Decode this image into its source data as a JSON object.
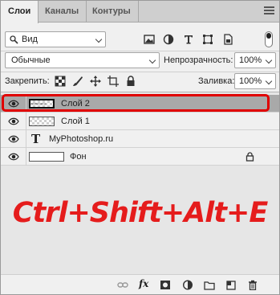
{
  "tabs": [
    {
      "label": "Слои",
      "active": true
    },
    {
      "label": "Каналы",
      "active": false
    },
    {
      "label": "Контуры",
      "active": false
    }
  ],
  "filter": {
    "kind_label": "Вид",
    "icons": [
      "image-filter-icon",
      "adjustment-filter-icon",
      "type-filter-icon",
      "shape-filter-icon",
      "smart-object-filter-icon"
    ]
  },
  "blend": {
    "mode": "Обычные",
    "opacity_label": "Непрозрачность:",
    "opacity_value": "100%"
  },
  "lock": {
    "label": "Закрепить:",
    "fill_label": "Заливка:",
    "fill_value": "100%"
  },
  "layers": [
    {
      "name": "Слой 2",
      "selected": true,
      "type": "raster",
      "thumb_text": "MyPhotoshop"
    },
    {
      "name": "Слой 1",
      "selected": false,
      "type": "raster"
    },
    {
      "name": "MyPhotoshop.ru",
      "selected": false,
      "type": "text"
    },
    {
      "name": "Фон",
      "selected": false,
      "type": "background",
      "locked": true
    }
  ],
  "overlay": {
    "shortcut": "Ctrl+Shift+Alt+E",
    "color": "#e51c1c"
  },
  "bottom_icons": [
    "link-layers-icon",
    "fx-icon",
    "mask-icon",
    "adjustment-layer-icon",
    "folder-icon",
    "new-layer-icon",
    "trash-icon"
  ],
  "colors": {
    "panel_bg": "#f0f0f0",
    "selected_layer": "#a9a9a9",
    "highlight_border": "#e00000"
  }
}
